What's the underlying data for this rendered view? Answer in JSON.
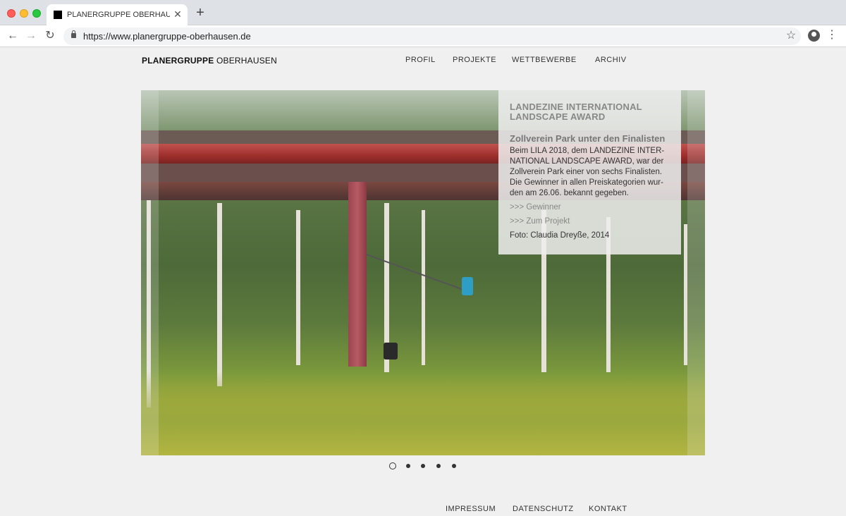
{
  "browser": {
    "tab_title": "PLANERGRUPPE OBERHAUSEN",
    "url": "https://www.planergruppe-oberhausen.de"
  },
  "site": {
    "logo_bold": "PLANERGRUPPE",
    "logo_light": " OBERHAUSEN",
    "nav": [
      "PROFIL",
      "PROJEKTE",
      "WETTBEWERBE",
      "ARCHIV"
    ],
    "footer": [
      "IMPRESSUM",
      "DATENSCHUTZ",
      "KONTAKT"
    ]
  },
  "slide": {
    "award_line1": "LANDEZINE INTERNATIONAL",
    "award_line2": "LANDSCAPE AWARD",
    "headline": "Zollverein Park unter den Finalisten",
    "body_lines": [
      "Beim LILA 2018, dem LANDEZINE INTER-",
      "NATIONAL LANDSCAPE AWARD, war der",
      "Zollverein Park einer von sechs Finalisten.",
      "Die Gewinner in allen Preiskategorien wur-",
      "den am 26.06. bekannt gegeben."
    ],
    "link_winners": ">>> Gewinner",
    "link_project": ">>> Zum Projekt",
    "photo_credit": "Foto: Claudia Dreyße, 2014"
  },
  "slider": {
    "count": 5,
    "active_index": 0
  }
}
